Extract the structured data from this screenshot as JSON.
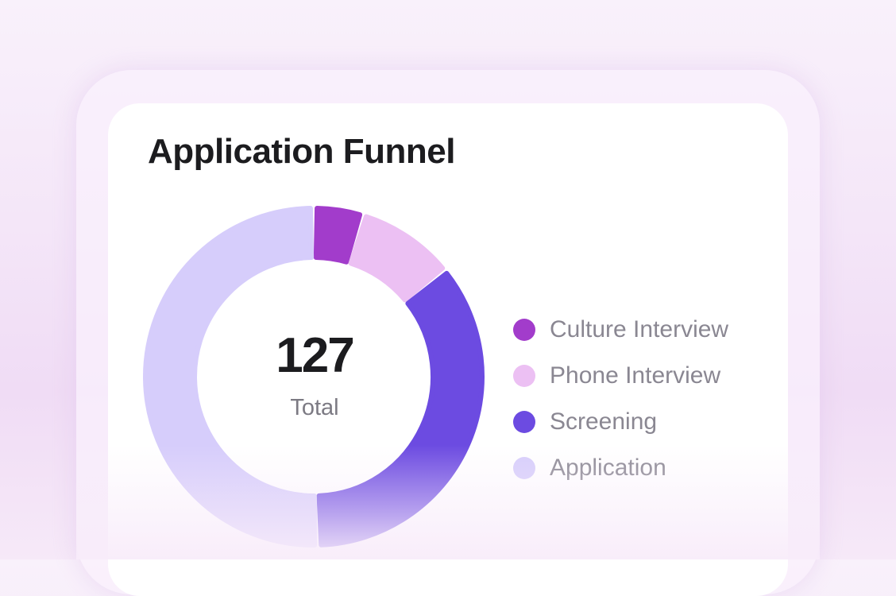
{
  "card": {
    "title": "Application Funnel"
  },
  "center": {
    "total": "127",
    "label": "Total"
  },
  "chart_data": {
    "type": "pie",
    "variant": "donut",
    "title": "Application Funnel",
    "total": 127,
    "slices": [
      {
        "label": "Culture Interview",
        "value": 6,
        "color": "#a23ccb"
      },
      {
        "label": "Phone Interview",
        "value": 12,
        "color": "#ecc0f3"
      },
      {
        "label": "Screening",
        "value": 45,
        "color": "#6c4be1"
      },
      {
        "label": "Application",
        "value": 64,
        "color": "#d6cdfb"
      }
    ]
  },
  "legend": [
    {
      "label": "Culture Interview",
      "color": "#a23ccb"
    },
    {
      "label": "Phone Interview",
      "color": "#ecc0f3"
    },
    {
      "label": "Screening",
      "color": "#6c4be1"
    },
    {
      "label": "Application",
      "color": "#d6cdfb"
    }
  ]
}
